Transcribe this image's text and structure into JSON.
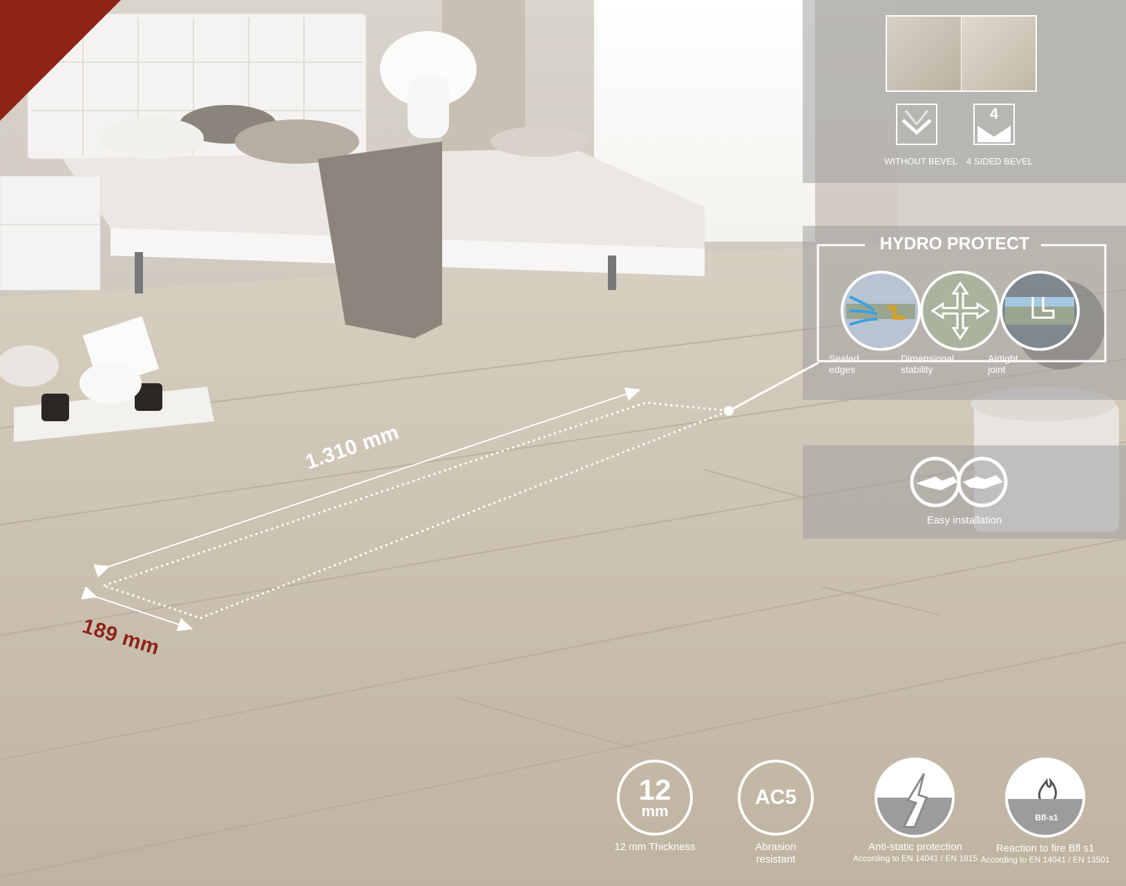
{
  "colors": {
    "accent": "#8e2418",
    "panel": "#9a9a9a",
    "floor": "#c9bfae"
  },
  "bevel": {
    "without_label": "WITHOUT BEVEL",
    "four_sided_label": "4 SIDED BEVEL",
    "four_number": "4"
  },
  "hydro": {
    "title": "HYDRO PROTECT",
    "items": [
      {
        "line1": "Sealed",
        "line2": "edges"
      },
      {
        "line1": "Dimensional",
        "line2": "stability"
      },
      {
        "line1": "Airtight",
        "line2": "joint"
      }
    ]
  },
  "installation": {
    "label": "Easy installation"
  },
  "dimensions": {
    "length": "1.310 mm",
    "width": "189 mm"
  },
  "features": [
    {
      "badge_big": "12",
      "badge_small": "mm",
      "label": "12 mm Thickness",
      "sub": ""
    },
    {
      "badge_big": "AC5",
      "badge_small": "",
      "label": "Abrasion resistant",
      "sub": ""
    },
    {
      "badge_big": "",
      "badge_small": "",
      "label": "Anti-static protection",
      "sub": "According to EN 14041 / EN 1815"
    },
    {
      "badge_big": "",
      "badge_small": "Bfl-s1",
      "label": "Reaction to fire Bfl s1",
      "sub": "According to EN 14041 / EN 13501"
    }
  ]
}
